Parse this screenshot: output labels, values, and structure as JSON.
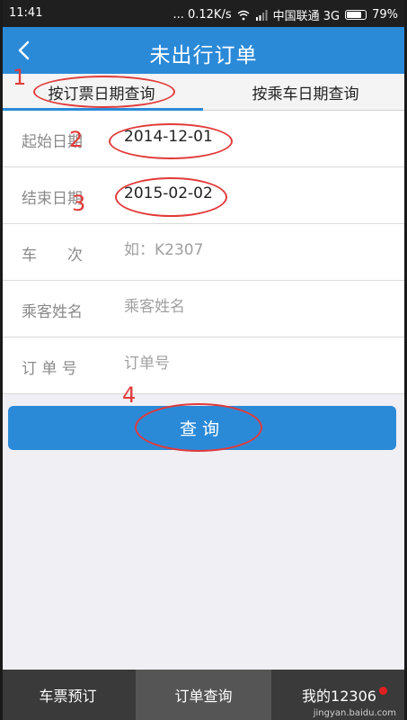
{
  "status_bar": {
    "time": "11:41",
    "network_speed": "... 0.12K/s",
    "carrier": "中国联通 3G",
    "battery": "79%"
  },
  "header": {
    "title": "未出行订单",
    "back_icon": "chevron-left-icon"
  },
  "tabs": [
    {
      "label": "按订票日期查询",
      "active": true
    },
    {
      "label": "按乘车日期查询",
      "active": false
    }
  ],
  "form": {
    "start_date": {
      "label": "起始日期",
      "value": "2014-12-01"
    },
    "end_date": {
      "label": "结束日期",
      "value": "2015-02-02"
    },
    "train_no": {
      "label": "车　　次",
      "placeholder": "如：K2307"
    },
    "passenger_name": {
      "label": "乘客姓名",
      "placeholder": "乘客姓名"
    },
    "order_no": {
      "label": "订 单 号",
      "placeholder": "订单号"
    }
  },
  "query_button": {
    "label": "查询"
  },
  "annotations": [
    "1",
    "2",
    "3",
    "4"
  ],
  "bottom_nav": [
    {
      "label": "车票预订"
    },
    {
      "label": "订单查询",
      "active": true
    },
    {
      "label": "我的12306"
    }
  ],
  "watermark": "jingyan.baidu.com",
  "colors": {
    "primary": "#2b8ad8",
    "annotation": "#e23a3a",
    "nav_bg": "#3a3a3a"
  }
}
